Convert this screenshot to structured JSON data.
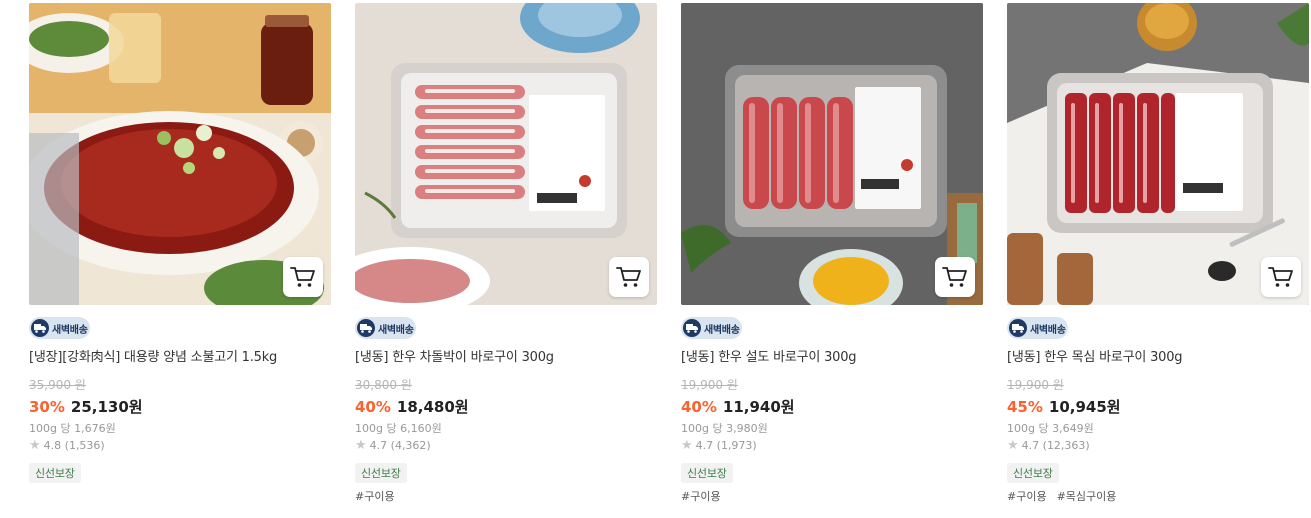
{
  "badge_label": "새벽배송",
  "fresh_tag": "신선보장",
  "colors": {
    "discount": "#fa622f",
    "badge_bg": "#d9e4f1",
    "badge_fg": "#1f3a64"
  },
  "products": [
    {
      "title": "[냉장][강화肉식] 대용량 양념 소불고기 1.5kg",
      "original_price": "35,900 원",
      "discount_rate": "30%",
      "sale_price": "25,130원",
      "unit_price": "100g 당 1,676원",
      "rating": "4.8 (1,536)",
      "hashtags": []
    },
    {
      "title": "[냉동] 한우 차돌박이 바로구이 300g",
      "original_price": "30,800 원",
      "discount_rate": "40%",
      "sale_price": "18,480원",
      "unit_price": "100g 당 6,160원",
      "rating": "4.7 (4,362)",
      "hashtags": [
        "#구이용"
      ]
    },
    {
      "title": "[냉동] 한우 설도 바로구이 300g",
      "original_price": "19,900 원",
      "discount_rate": "40%",
      "sale_price": "11,940원",
      "unit_price": "100g 당 3,980원",
      "rating": "4.7 (1,973)",
      "hashtags": [
        "#구이용"
      ]
    },
    {
      "title": "[냉동] 한우 목심 바로구이 300g",
      "original_price": "19,900 원",
      "discount_rate": "45%",
      "sale_price": "10,945원",
      "unit_price": "100g 당 3,649원",
      "rating": "4.7 (12,363)",
      "hashtags": [
        "#구이용",
        "#목심구이용"
      ]
    }
  ]
}
